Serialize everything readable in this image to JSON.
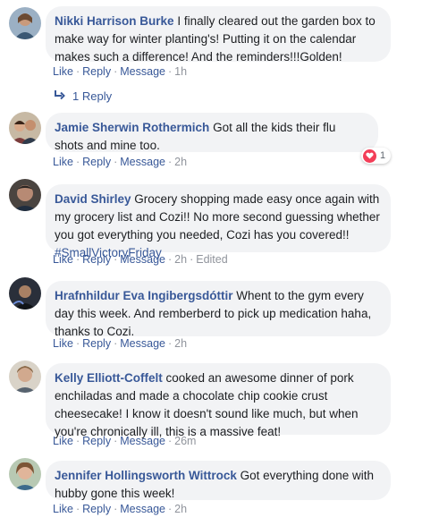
{
  "actions": {
    "like": "Like",
    "reply": "Reply",
    "message": "Message",
    "edited": "Edited",
    "separator": "·"
  },
  "comments": [
    {
      "author": "Nikki Harrison Burke",
      "text": " I finally cleared out the garden box to make way for winter planting's! Putting it on the calendar makes such a difference! And the reminders!!!Golden!",
      "time": "1h",
      "replies": "1 Reply"
    },
    {
      "author": "Jamie Sherwin Rothermich",
      "text": " Got all the kids their flu shots and mine too.",
      "time": "2h",
      "reaction_count": "1"
    },
    {
      "author": "David Shirley",
      "text": " Grocery shopping made easy once again with my grocery list and Cozi!! No more second guessing whether you got everything you needed, Cozi has you covered!! ",
      "hashtag": "#SmallVictoryFriday",
      "time": "2h"
    },
    {
      "author": "Hrafnhildur Eva Ingibergsdóttir",
      "text": " Whent to the gym every day this week. And remberberd to pick up medication haha, thanks to Cozi.",
      "time": "2h"
    },
    {
      "author": "Kelly Elliott-Coffelt",
      "text": " cooked an awesome dinner of pork enchiladas and made a chocolate chip cookie crust cheesecake! I know it doesn't sound like much, but when you're chronically ill, this is a massive feat!",
      "time": "26m"
    },
    {
      "author": "Jennifer Hollingsworth Wittrock",
      "text": " Got everything done with hubby gone this week!",
      "time": "2h"
    }
  ],
  "colors": {
    "link": "#385898",
    "bubble": "#f2f3f5",
    "muted": "#90949c",
    "heart": "#f33e58"
  }
}
